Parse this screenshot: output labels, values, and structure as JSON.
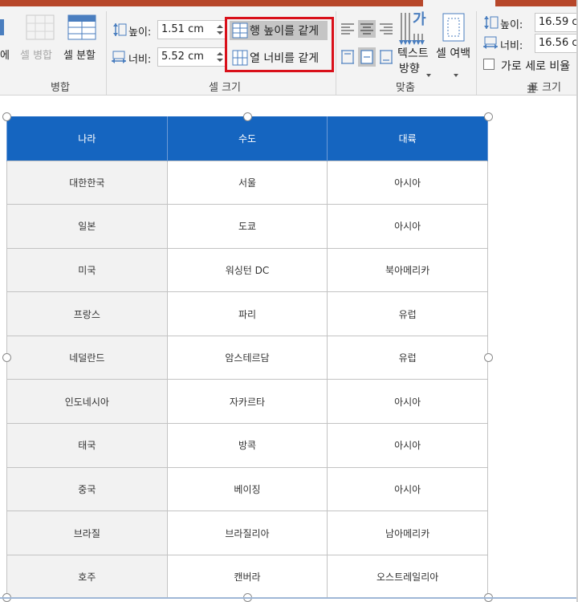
{
  "ribbon": {
    "merge_group": {
      "partial_label": "에",
      "merge_cells_label": "셀 병합",
      "split_cells_label": "셀 분할",
      "group_label": "병합"
    },
    "cell_size": {
      "height_label": "높이:",
      "height_value": "1.51 cm",
      "width_label": "너비:",
      "width_value": "5.52 cm",
      "distribute_rows_label": "행 높이를 같게",
      "distribute_cols_label": "열 너비를 같게",
      "group_label": "셀 크기"
    },
    "alignment": {
      "text_direction_line1": "텍스트",
      "text_direction_line2": "방향",
      "text_direction_icon_char": "가",
      "cell_margins_label": "셀 여백",
      "group_label": "맞춤"
    },
    "table_size": {
      "height_label": "높이:",
      "height_value": "16.59 c",
      "width_label": "너비:",
      "width_value": "16.56 c",
      "lock_ratio_label": "가로 세로 비율",
      "group_label": "표 크기"
    }
  },
  "table": {
    "headers": [
      "나라",
      "수도",
      "대륙"
    ],
    "rows": [
      [
        "대한한국",
        "서울",
        "아시아"
      ],
      [
        "일본",
        "도쿄",
        "아시아"
      ],
      [
        "미국",
        "워싱턴 DC",
        "북아메리카"
      ],
      [
        "프랑스",
        "파리",
        "유럽"
      ],
      [
        "네덜란드",
        "암스테르담",
        "유럽"
      ],
      [
        "인도네시아",
        "자카르타",
        "아시아"
      ],
      [
        "태국",
        "방콕",
        "아시아"
      ],
      [
        "중국",
        "베이징",
        "아시아"
      ],
      [
        "브라질",
        "브라질리아",
        "남아메리카"
      ],
      [
        "호주",
        "캔버라",
        "오스트레일리아"
      ]
    ]
  },
  "colors": {
    "header_blue": "#1565c0",
    "highlight_red": "#d9101a",
    "accent_orange": "#b7472a"
  }
}
